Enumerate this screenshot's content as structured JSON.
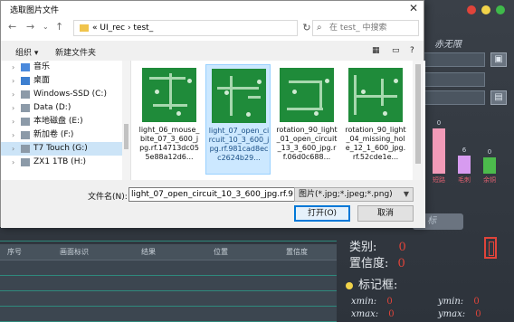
{
  "app": {
    "traffic_colors": [
      "#e0443a",
      "#f1d34a",
      "#3fb94a"
    ],
    "right_title": "赤无限",
    "chart": {
      "bars": [
        {
          "label": "短路",
          "value": "0",
          "color": "#f29bb8"
        },
        {
          "label": "毛刺",
          "value": "6",
          "color": "#d79bf0"
        },
        {
          "label": "余铜",
          "value": "0",
          "color": "#4cbb4c"
        }
      ]
    },
    "tag_pill": "标",
    "category_label": "类别:",
    "category_value": "0",
    "confidence_label": "置信度:",
    "confidence_value": "0",
    "marker_heading": "标记框:",
    "xmin_label": "xmin:",
    "xmin_value": "0",
    "ymin_label": "ymin:",
    "ymin_value": "0",
    "xmax_label": "xmax:",
    "xmax_value": "0",
    "ymax_label": "ymax:",
    "ymax_value": "0",
    "table_headers": [
      "序号",
      "画面标识",
      "结果",
      "位置",
      "置信度"
    ]
  },
  "dialog": {
    "title": "选取图片文件",
    "address_path": "« UI_rec › test_",
    "search_placeholder": "在 test_ 中搜索",
    "toolbar": {
      "organize": "组织 ▾",
      "new_folder": "新建文件夹"
    },
    "nav_items": [
      {
        "label": "音乐",
        "icon": "music-icon",
        "selected": false
      },
      {
        "label": "桌面",
        "icon": "desktop-icon",
        "selected": false
      },
      {
        "label": "Windows-SSD (C:)",
        "icon": "drive-icon",
        "selected": false
      },
      {
        "label": "Data (D:)",
        "icon": "drive-icon",
        "selected": false
      },
      {
        "label": "本地磁盘 (E:)",
        "icon": "drive-icon",
        "selected": false
      },
      {
        "label": "新加卷 (F:)",
        "icon": "drive-icon",
        "selected": false
      },
      {
        "label": "T7 Touch (G:)",
        "icon": "drive-icon",
        "selected": true
      },
      {
        "label": "ZX1 1TB (H:)",
        "icon": "drive-icon",
        "selected": false
      }
    ],
    "files": [
      {
        "name": "light_06_mouse_bite_07_3_600_jpg.rf.14713dc055e88a12d6...",
        "selected": false
      },
      {
        "name": "light_07_open_circuit_10_3_600_jpg.rf.981cad8ecc2624b29...",
        "selected": true
      },
      {
        "name": "rotation_90_light_01_open_circuit_13_3_600_jpg.rf.06d0c688...",
        "selected": false
      },
      {
        "name": "rotation_90_light_04_missing_hole_12_1_600_jpg.rf.52cde1e...",
        "selected": false
      }
    ],
    "filename_label": "文件名(N):",
    "filename_value": "light_07_open_circuit_10_3_600_jpg.rf.9",
    "filter_value": "图片(*.jpg;*.jpeg;*.png)",
    "open_button": "打开(O)",
    "cancel_button": "取消"
  }
}
